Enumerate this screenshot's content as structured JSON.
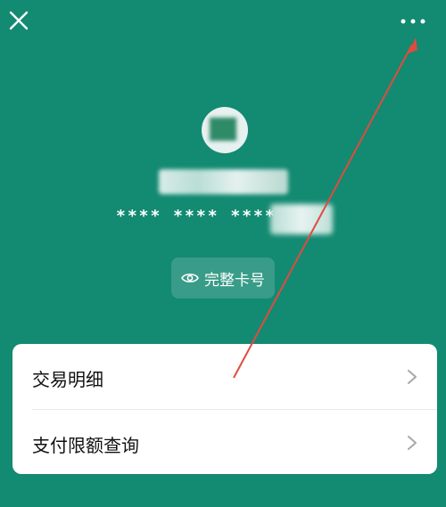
{
  "header": {
    "close_icon": "close-icon",
    "more_icon": "more-horizontal-icon"
  },
  "card": {
    "masked_number": "**** **** ****",
    "full_card_button": "完整卡号",
    "eye_icon": "eye-icon"
  },
  "menu": {
    "items": [
      {
        "label": "交易明细",
        "icon": "chevron-right-icon"
      },
      {
        "label": "支付限额查询",
        "icon": "chevron-right-icon"
      }
    ]
  },
  "colors": {
    "background": "#138a72",
    "card": "#ffffff",
    "annotation_arrow": "#e04b3f"
  }
}
